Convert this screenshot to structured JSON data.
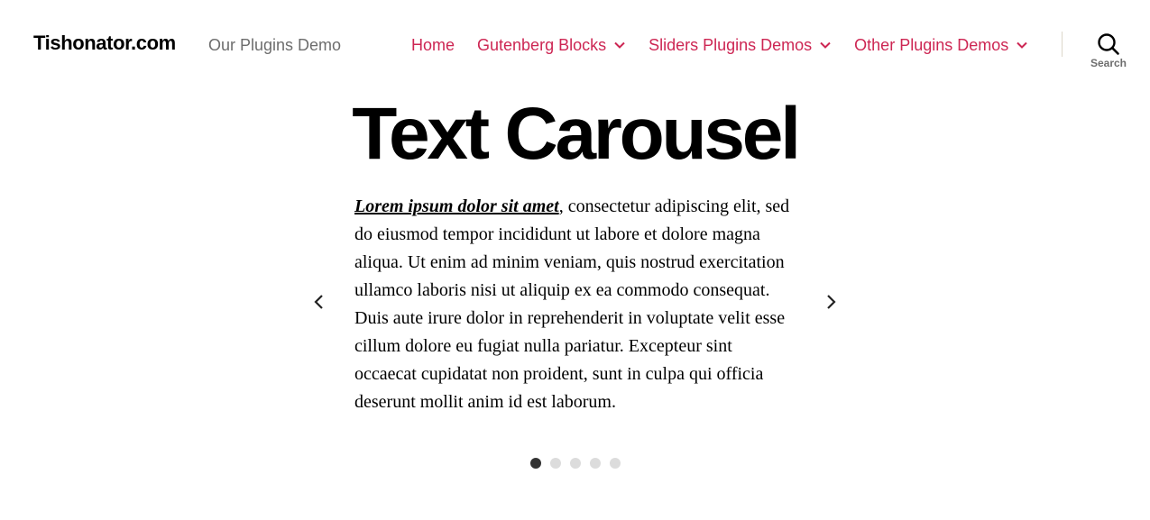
{
  "header": {
    "site_title": "Tishonator.com",
    "site_description": "Our Plugins Demo",
    "nav": [
      {
        "label": "Home",
        "has_dropdown": false
      },
      {
        "label": "Gutenberg Blocks",
        "has_dropdown": true
      },
      {
        "label": "Sliders Plugins Demos",
        "has_dropdown": true
      },
      {
        "label": "Other Plugins Demos",
        "has_dropdown": true
      }
    ],
    "search_label": "Search"
  },
  "colors": {
    "accent": "#cd2653",
    "secondary_text": "#6d6d6d",
    "dot_active": "#333333",
    "dot_inactive": "#dcdcdc"
  },
  "main": {
    "page_title": "Text Carousel",
    "carousel": {
      "slide_lead": "Lorem ipsum dolor sit amet",
      "slide_rest": ", consectetur adipiscing elit, sed do eiusmod tempor incididunt ut labore et dolore magna aliqua. Ut enim ad minim veniam, quis nostrud exercitation ullamco laboris nisi ut aliquip ex ea commodo consequat. Duis aute irure dolor in reprehenderit in voluptate velit esse cillum dolore eu fugiat nulla pariatur. Excepteur sint occaecat cupidatat non proident, sunt in culpa qui officia deserunt mollit anim id est laborum.",
      "prev_icon": "chevron-left-icon",
      "next_icon": "chevron-right-icon",
      "slide_count": 5,
      "active_slide": 1
    }
  }
}
